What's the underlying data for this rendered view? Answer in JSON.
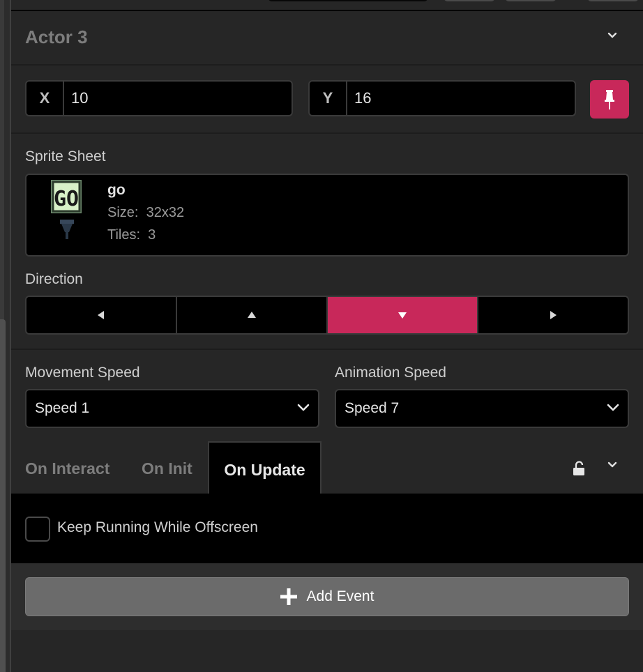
{
  "actor": {
    "title": "Actor 3"
  },
  "position": {
    "x_label": "X",
    "x_value": "10",
    "y_label": "Y",
    "y_value": "16"
  },
  "sprite": {
    "section_label": "Sprite Sheet",
    "name": "go",
    "size_label": "Size:",
    "size_value": "32x32",
    "tiles_label": "Tiles:",
    "tiles_value": "3",
    "thumbnail_text": "GO"
  },
  "direction": {
    "section_label": "Direction",
    "options": [
      "left",
      "up",
      "down",
      "right"
    ],
    "selected": "down"
  },
  "movement_speed": {
    "label": "Movement Speed",
    "value": "Speed 1"
  },
  "animation_speed": {
    "label": "Animation Speed",
    "value": "Speed 7"
  },
  "tabs": [
    {
      "label": "On Interact"
    },
    {
      "label": "On Init"
    },
    {
      "label": "On Update"
    }
  ],
  "active_tab": "On Update",
  "script": {
    "checkbox_label": "Keep Running While Offscreen",
    "checked": false
  },
  "add_event": {
    "label": "Add Event"
  },
  "colors": {
    "accent": "#c8285a",
    "panel_bg": "#262626",
    "field_bg": "#000000"
  }
}
